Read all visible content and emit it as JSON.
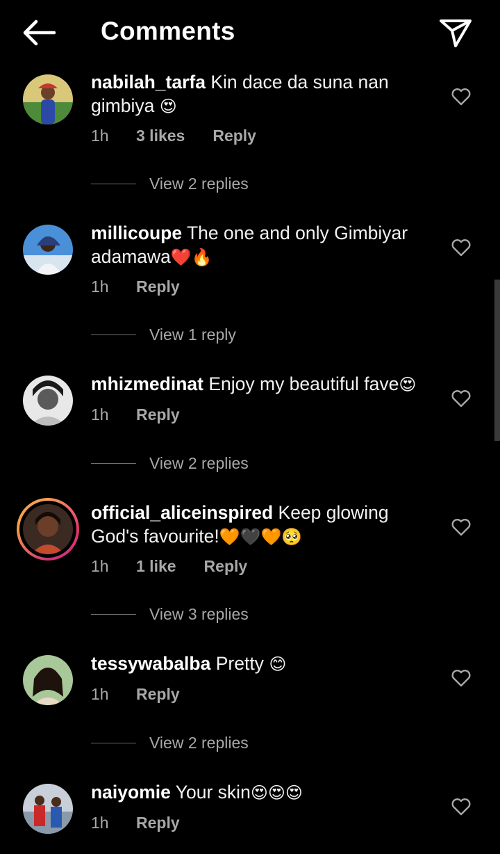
{
  "header": {
    "title": "Comments",
    "back_icon": "arrow-left-icon",
    "send_icon": "paper-plane-icon"
  },
  "comments": [
    {
      "username": "nabilah_tarfa",
      "text_line1": "Kin dace da suna nan",
      "text_line2": "gimbiya",
      "emoji2": "😍",
      "time": "1h",
      "likes": "3 likes",
      "reply": "Reply",
      "view_replies": "View 2 replies"
    },
    {
      "username": "millicoupe",
      "text_line1": "The one and only Gimbiyar",
      "text_line2": "adamawa",
      "emoji2": "❤️🔥",
      "time": "1h",
      "reply": "Reply",
      "view_replies": "View 1 reply"
    },
    {
      "username": "mhizmedinat",
      "text_line1": "Enjoy my beautiful fave",
      "emoji1": "😍",
      "time": "1h",
      "reply": "Reply",
      "view_replies": "View 2 replies"
    },
    {
      "username": "official_aliceinspired",
      "text_line1": "Keep glowing",
      "text_line2": "God's favourite!",
      "emoji2": "🧡🖤🧡🥺",
      "time": "1h",
      "likes": "1 like",
      "reply": "Reply",
      "view_replies": "View 3 replies"
    },
    {
      "username": "tessywabalba",
      "text_line1": "Pretty",
      "emoji1": "😊",
      "time": "1h",
      "reply": "Reply",
      "view_replies": "View 2 replies"
    },
    {
      "username": "naiyomie",
      "text_line1": "Your skin",
      "emoji1": "😍😍😍",
      "time": "1h",
      "reply": "Reply"
    }
  ],
  "colors": {
    "background": "#000000",
    "text": "#ffffff",
    "muted": "#a8a8a8",
    "story_ring": "#e0356b"
  }
}
